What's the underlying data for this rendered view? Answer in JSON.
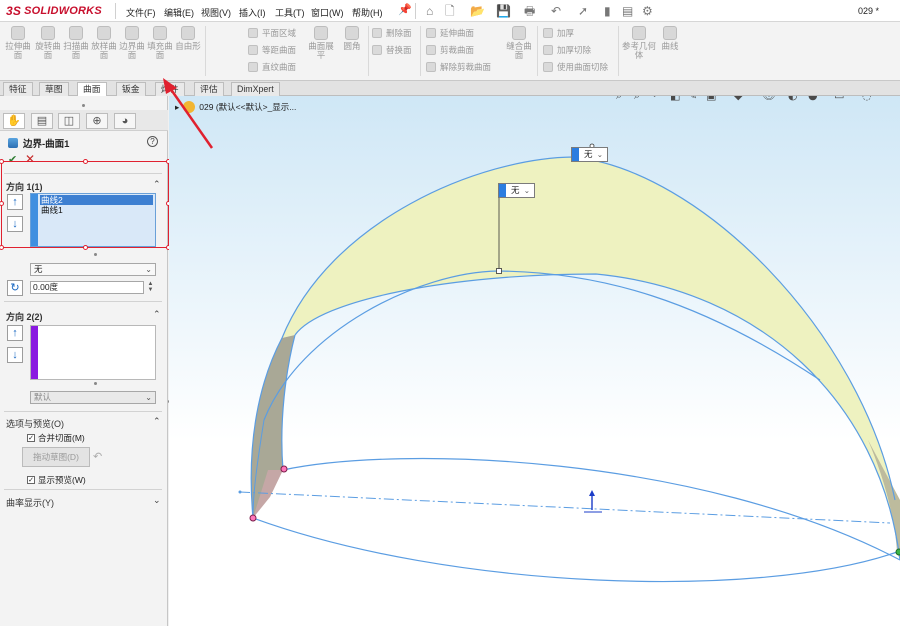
{
  "app": {
    "brand_prefix": "3S",
    "brand": "SOLIDWORKS",
    "doc_title": "029 *"
  },
  "menu": [
    "文件(F)",
    "编辑(E)",
    "视图(V)",
    "插入(I)",
    "工具(T)",
    "窗口(W)",
    "帮助(H)"
  ],
  "ribbon": {
    "big_buttons": [
      "拉伸曲面",
      "旋转曲面",
      "扫描曲面",
      "放样曲面",
      "边界曲面",
      "填充曲面",
      "自由形"
    ],
    "col1": [
      "平面区域",
      "等距曲面",
      "直纹曲面"
    ],
    "surface_flatten": "曲面展平",
    "fillet": "圆角",
    "col2": [
      "删除面",
      "替换面"
    ],
    "col3": [
      "延伸曲面",
      "剪裁曲面",
      "解除剪裁曲面"
    ],
    "knit": "缝合曲面",
    "col4": [
      "加厚",
      "加厚切除",
      "使用曲面切除"
    ],
    "refgeo": "参考几何体",
    "curves": "曲线"
  },
  "tabs": [
    "特征",
    "草图",
    "曲面",
    "钣金",
    "焊件",
    "评估",
    "DimXpert"
  ],
  "active_tab": "曲面",
  "panel": {
    "tab_icons": [
      "feature-manager-icon",
      "property-manager-icon",
      "configuration-manager-icon",
      "dimxpert-manager-icon",
      "display-manager-icon"
    ],
    "title": "边界-曲面1",
    "direction1": {
      "header": "方向 1(1)",
      "curves": [
        "曲线2",
        "曲线1"
      ],
      "selected_curve": "曲线2",
      "tangency": "无",
      "angle": "0.00度"
    },
    "direction2": {
      "header": "方向 2(2)",
      "tangency": "默认"
    },
    "options": {
      "header": "选项与预览(O)",
      "merge_tangent_faces": "合并切面(M)",
      "merge_tangent_checked": true,
      "edit_sketch": "拖动草图(D)",
      "show_preview": "显示预览(W)",
      "show_preview_checked": true
    },
    "curvature": {
      "header": "曲率显示(Y)"
    }
  },
  "viewport": {
    "tree_item": "029  (默认<<默认>_显示...",
    "callout1": "无",
    "callout2": "无"
  },
  "colors": {
    "brand_red": "#c8102e",
    "highlight_red": "#e0212f",
    "surface": "#f1f4c4",
    "edge": "#5b9de2",
    "dir1_bar": "#3f8fe0",
    "dir2_bar": "#8a1be0"
  }
}
